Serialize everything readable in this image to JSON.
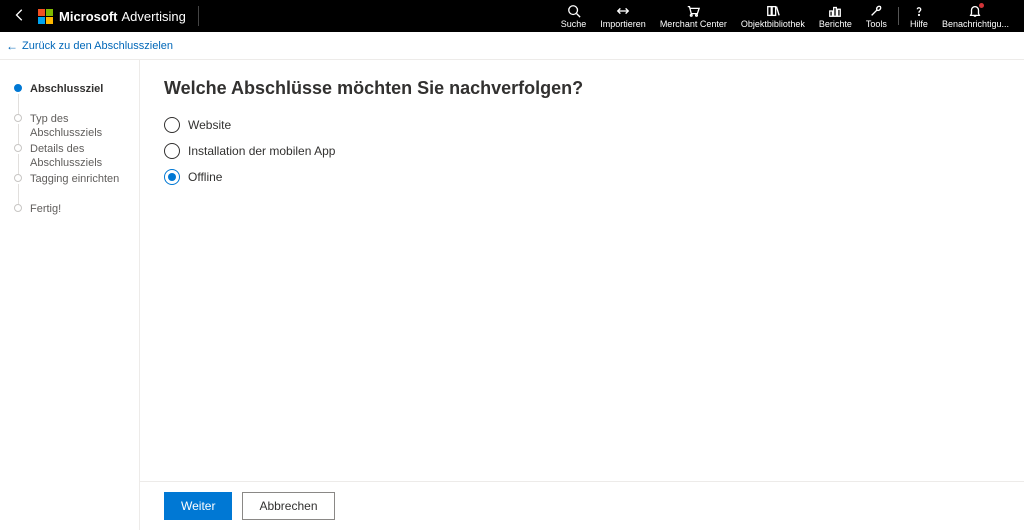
{
  "header": {
    "brand_primary": "Microsoft",
    "brand_secondary": "Advertising",
    "nav": [
      {
        "id": "search",
        "label": "Suche"
      },
      {
        "id": "import",
        "label": "Importieren"
      },
      {
        "id": "merchant",
        "label": "Merchant Center"
      },
      {
        "id": "objects",
        "label": "Objektbibliothek"
      },
      {
        "id": "reports",
        "label": "Berichte"
      },
      {
        "id": "tools",
        "label": "Tools"
      }
    ],
    "help_label": "Hilfe",
    "notifications_label": "Benachrichtigu..."
  },
  "backlink": "Zurück zu den Abschlusszielen",
  "steps": [
    {
      "label": "Abschlussziel",
      "active": true
    },
    {
      "label": "Typ des Abschlussziels",
      "active": false
    },
    {
      "label": "Details des Abschlussziels",
      "active": false
    },
    {
      "label": "Tagging einrichten",
      "active": false
    },
    {
      "label": "Fertig!",
      "active": false
    }
  ],
  "main": {
    "title": "Welche Abschlüsse möchten Sie nachverfolgen?",
    "options": [
      {
        "label": "Website",
        "selected": false
      },
      {
        "label": "Installation der mobilen App",
        "selected": false
      },
      {
        "label": "Offline",
        "selected": true
      }
    ]
  },
  "footer": {
    "primary": "Weiter",
    "secondary": "Abbrechen"
  }
}
